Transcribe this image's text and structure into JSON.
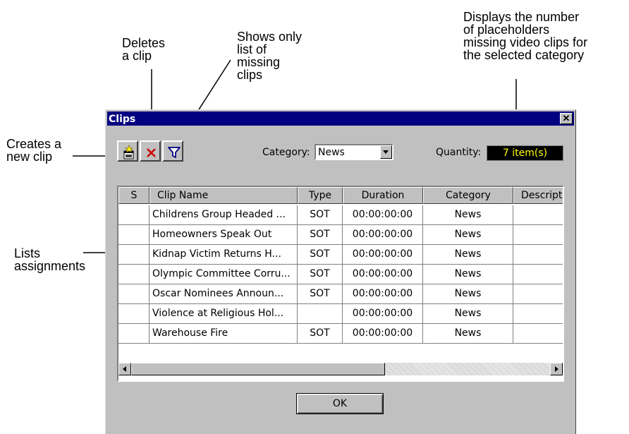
{
  "callouts": {
    "deletes": "Deletes\na clip",
    "filter": "Shows only\nlist of\nmissing\nclips",
    "quantity": "Displays the number\nof placeholders\nmissing video clips for\nthe selected category",
    "creates": "Creates a\nnew clip",
    "lists": "Lists\nassignments"
  },
  "window": {
    "title": "Clips",
    "close_label": "✕"
  },
  "toolbar": {
    "new_clip_icon": "new-clip-icon",
    "delete_icon": "delete-x-icon",
    "filter_icon": "funnel-filter-icon",
    "category_label": "Category:",
    "category_value": "News",
    "quantity_label": "Quantity:",
    "quantity_value": "7 item(s)"
  },
  "table": {
    "columns": [
      "S",
      "Clip Name",
      "Type",
      "Duration",
      "Category",
      "Descript"
    ],
    "rows": [
      [
        "",
        "Childrens Group Headed ...",
        "SOT",
        "00:00:00:00",
        "News",
        ""
      ],
      [
        "",
        "Homeowners Speak Out",
        "SOT",
        "00:00:00:00",
        "News",
        ""
      ],
      [
        "",
        "Kidnap Victim Returns H...",
        "SOT",
        "00:00:00:00",
        "News",
        ""
      ],
      [
        "",
        "Olympic Committee Corru...",
        "SOT",
        "00:00:00:00",
        "News",
        ""
      ],
      [
        "",
        "Oscar Nominees Announ...",
        "SOT",
        "00:00:00:00",
        "News",
        ""
      ],
      [
        "",
        "Violence at Religious Hol...",
        "",
        "00:00:00:00",
        "News",
        ""
      ],
      [
        "",
        "Warehouse Fire",
        "SOT",
        "00:00:00:00",
        "News",
        ""
      ]
    ]
  },
  "buttons": {
    "ok_label": "OK"
  },
  "colors": {
    "title_bar": "#000080",
    "quantity_bg": "#000000",
    "quantity_text": "#ffff00",
    "window_bg": "#c0c0c0"
  }
}
